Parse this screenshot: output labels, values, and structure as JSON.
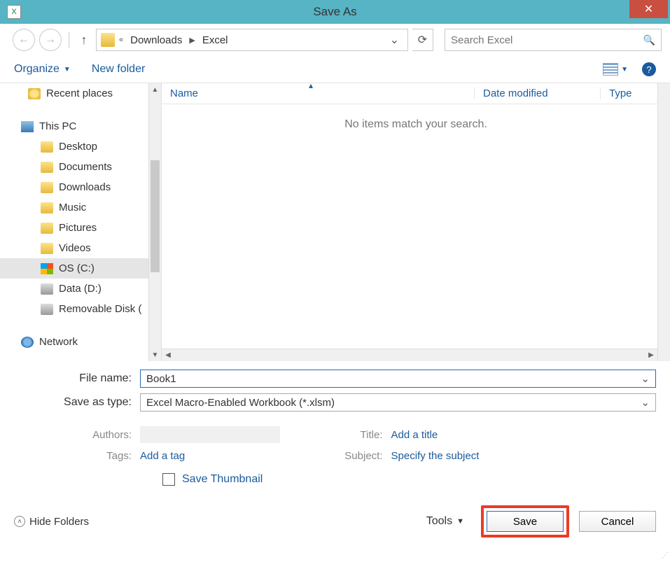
{
  "title": "Save As",
  "nav": {
    "back": "←",
    "forward": "→",
    "up": "↑",
    "refresh": "⟳"
  },
  "breadcrumb": {
    "overflow": "«",
    "seg1": "Downloads",
    "seg2": "Excel"
  },
  "search": {
    "placeholder": "Search Excel"
  },
  "toolbar": {
    "organize": "Organize",
    "newfolder": "New folder"
  },
  "columns": {
    "name": "Name",
    "date": "Date modified",
    "type": "Type"
  },
  "empty": "No items match your search.",
  "sidebar": {
    "recent": "Recent places",
    "thispc": "This PC",
    "items": [
      "Desktop",
      "Documents",
      "Downloads",
      "Music",
      "Pictures",
      "Videos"
    ],
    "osc": "OS (C:)",
    "datad": "Data (D:)",
    "remov": "Removable Disk (",
    "network": "Network"
  },
  "form": {
    "fname_label": "File name:",
    "fname": "Book1",
    "ftype_label": "Save as type:",
    "ftype": "Excel Macro-Enabled Workbook (*.xlsm)"
  },
  "meta": {
    "authors_l": "Authors:",
    "tags_l": "Tags:",
    "tags_v": "Add a tag",
    "title_l": "Title:",
    "title_v": "Add a title",
    "subject_l": "Subject:",
    "subject_v": "Specify the subject"
  },
  "thumb": "Save Thumbnail",
  "footer": {
    "hide": "Hide Folders",
    "tools": "Tools",
    "save": "Save",
    "cancel": "Cancel"
  }
}
